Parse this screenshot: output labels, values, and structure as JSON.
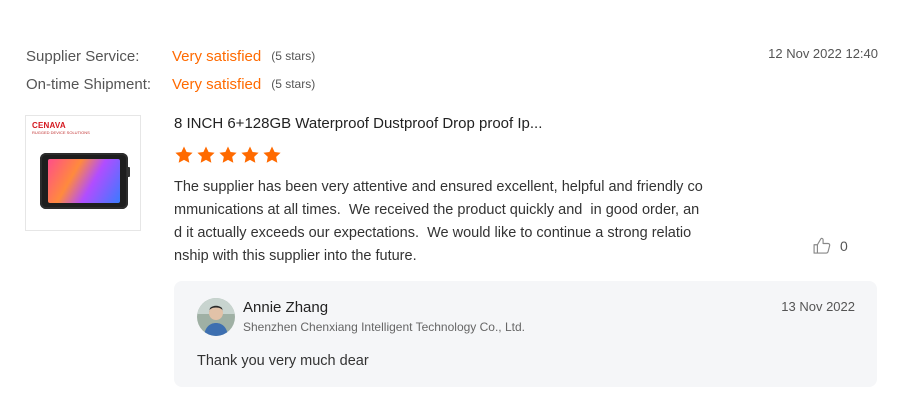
{
  "ratings": [
    {
      "label": "Supplier Service:",
      "value": "Very satisfied",
      "count": "(5 stars)"
    },
    {
      "label": "On-time Shipment:",
      "value": "Very satisfied",
      "count": "(5 stars)"
    }
  ],
  "review": {
    "date": "12 Nov 2022 12:40",
    "product": {
      "brand": "CENAVA",
      "brand_tagline": "RUGGED DEVICE SOLUTIONS",
      "title": "8 INCH 6+128GB Waterproof Dustproof Drop proof Ip..."
    },
    "stars": 5,
    "text_lines": [
      "The supplier has been very attentive and ensured excellent, helpful and friendly co",
      "mmunications at all times.  We received the product quickly and  in good order, an",
      "d it actually exceeds our expectations.  We would like to continue a strong relatio",
      "nship with this supplier into the future."
    ],
    "likes": "0"
  },
  "reply": {
    "name": "Annie Zhang",
    "company": "Shenzhen Chenxiang Intelligent Technology Co., Ltd.",
    "date": "13 Nov 2022",
    "text": "Thank you very much dear"
  },
  "colors": {
    "accent": "#ff6a00",
    "reply_bg": "#f5f6f8"
  },
  "icons": {
    "star": "star-icon",
    "like": "thumbs-up-icon"
  }
}
